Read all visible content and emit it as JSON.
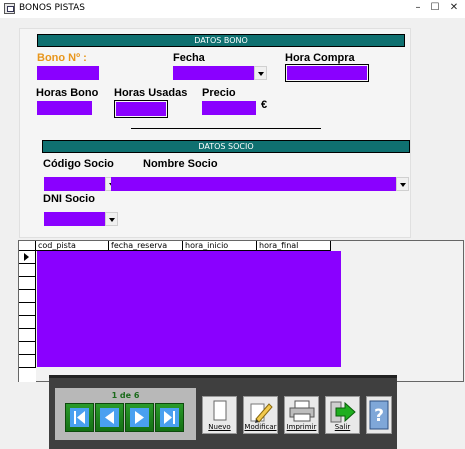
{
  "window": {
    "title": "BONOS PISTAS",
    "minimize": "–",
    "maximize": "☐",
    "close": "✕"
  },
  "datos_bono": {
    "header": "DATOS BONO",
    "bono_label": "Bono Nº :",
    "fecha_label": "Fecha",
    "hora_compra_label": "Hora Compra",
    "horas_bono_label": "Horas Bono",
    "horas_usadas_label": "Horas Usadas",
    "precio_label": "Precio",
    "currency": "€"
  },
  "datos_socio": {
    "header": "DATOS SOCIO",
    "codigo_label": "Código Socio",
    "nombre_label": "Nombre Socio",
    "dni_label": "DNI Socio"
  },
  "grid": {
    "columns": [
      "cod_pista",
      "fecha_reserva",
      "hora_inicio",
      "hora_final"
    ]
  },
  "toolbar": {
    "record_position": "1 de 6",
    "nuevo": "Nuevo",
    "modificar": "Modificar",
    "imprimir": "Imprimir",
    "salir": "Salir"
  },
  "icons": {
    "first": "first-record-icon",
    "prev": "previous-record-icon",
    "next": "next-record-icon",
    "last": "last-record-icon",
    "new": "new-document-icon",
    "edit": "pencil-icon",
    "print": "printer-icon",
    "exit": "exit-arrow-icon",
    "help": "help-icon"
  },
  "colors": {
    "field_fill": "#8a00ff",
    "section_header": "#0f7070",
    "highlight_label": "#e8961c",
    "nav_text": "#1c6b1c"
  }
}
